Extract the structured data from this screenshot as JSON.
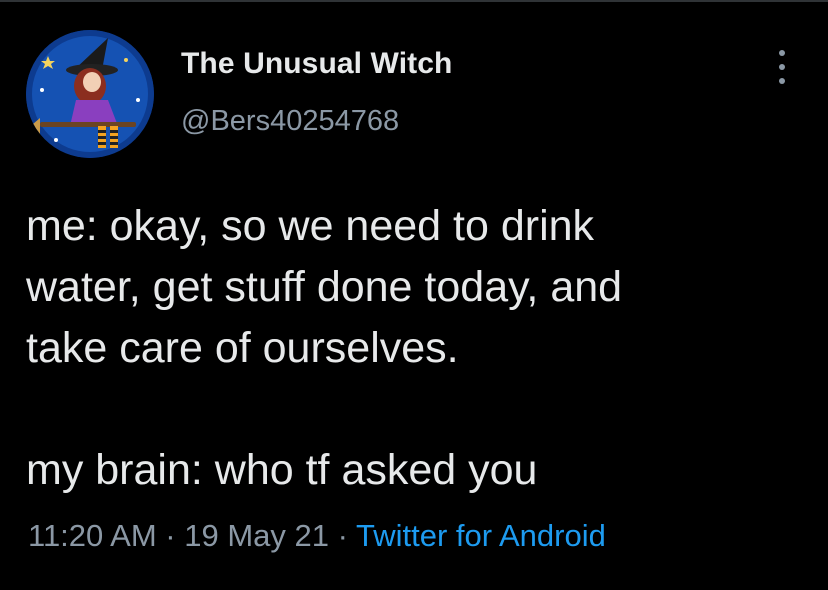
{
  "author": {
    "display_name": "The Unusual Witch",
    "handle": "@Bers40254768",
    "avatar_icon": "witch-on-broom-avatar"
  },
  "menu": {
    "icon": "more-options-icon"
  },
  "tweet": {
    "lines_part1": [
      "me: okay, so we need to drink",
      "water, get stuff done today, and",
      "take care of ourselves."
    ],
    "lines_part2": [
      "my brain: who tf asked you"
    ]
  },
  "meta": {
    "time": "11:20 AM",
    "sep1": " · ",
    "date": "19 May 21",
    "sep2": " · ",
    "source": "Twitter for Android"
  },
  "colors": {
    "background": "#000000",
    "text": "#e7e9ea",
    "secondary": "#8b98a5",
    "link": "#1d9bf0"
  }
}
